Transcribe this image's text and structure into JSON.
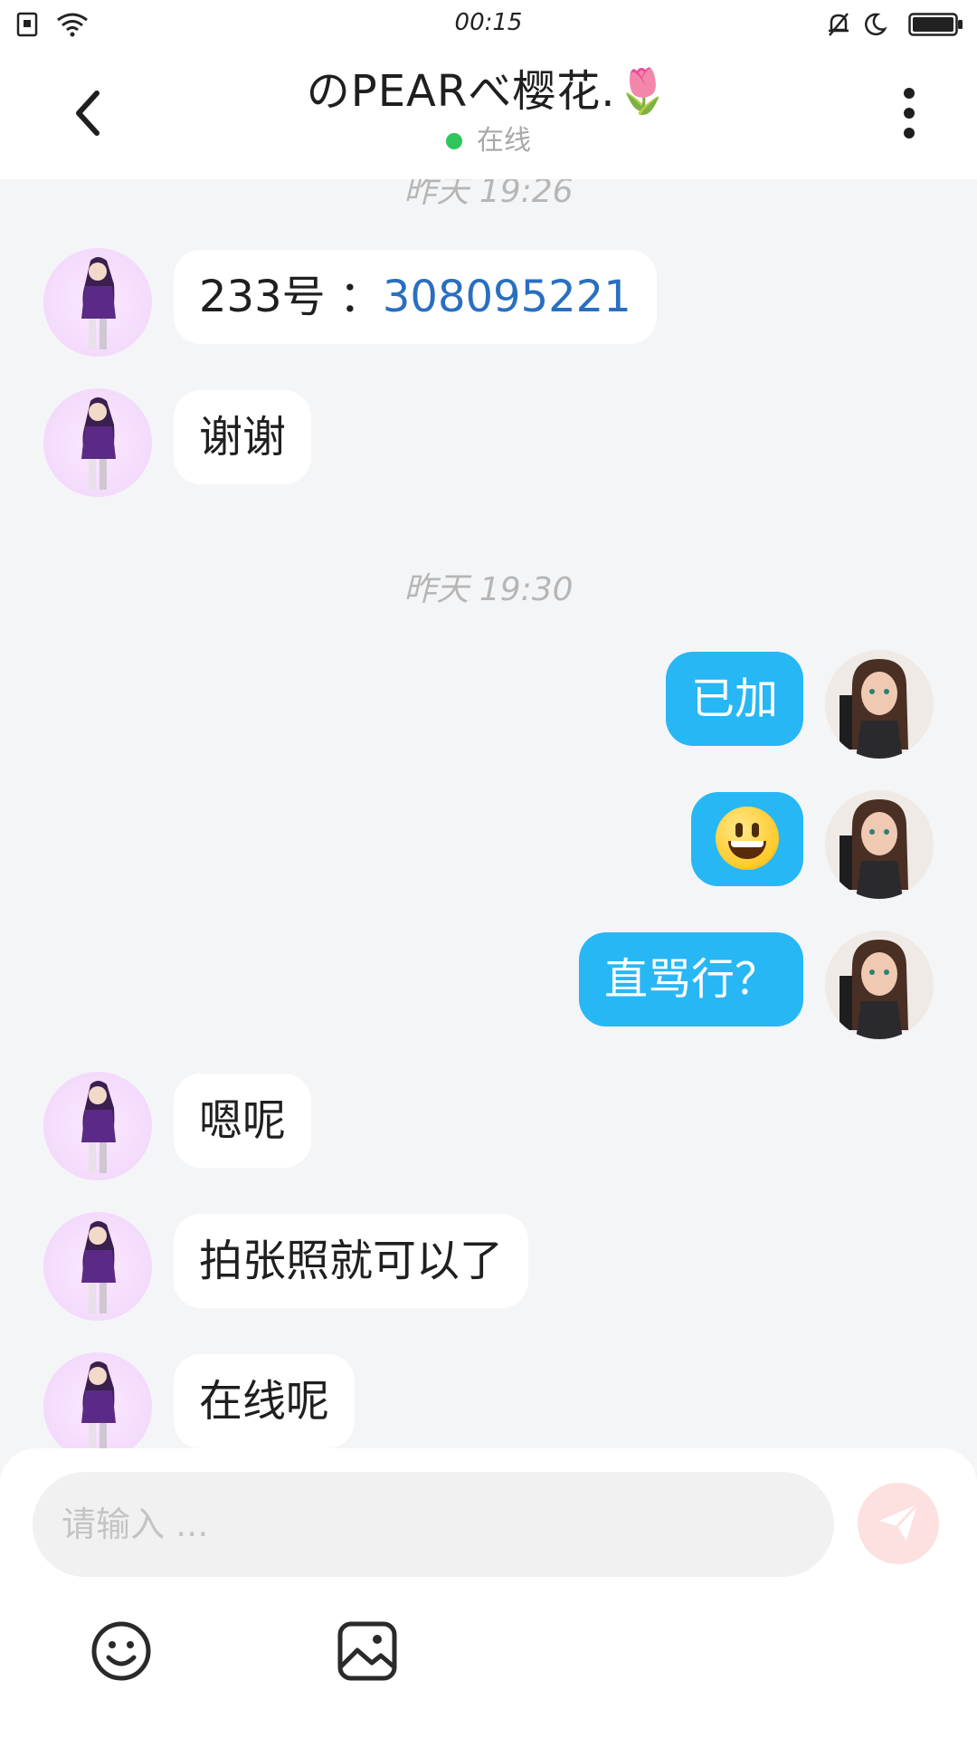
{
  "status_bar": {
    "time": "00:15",
    "icons": [
      "sim-card-icon",
      "wifi-icon",
      "mute-bell-icon",
      "moon-icon",
      "battery-icon"
    ]
  },
  "header": {
    "title": "のPEARべ樱花.🌷",
    "status": "在线",
    "back_icon": "chevron-left-icon",
    "more_icon": "more-vertical-icon"
  },
  "chat": {
    "timestamp_top": "昨天 19:26",
    "timestamp_mid": "昨天 19:30",
    "messages": [
      {
        "side": "in",
        "prefix": "233号 ：",
        "number": "308095221"
      },
      {
        "side": "in",
        "text": "谢谢"
      },
      {
        "side": "out",
        "text": "已加"
      },
      {
        "side": "out",
        "emoji": "smiley-emoji"
      },
      {
        "side": "out",
        "text": "直骂行？"
      },
      {
        "side": "in",
        "text": "嗯呢"
      },
      {
        "side": "in",
        "text": "拍张照就可以了"
      },
      {
        "side": "in",
        "text": "在线呢"
      }
    ]
  },
  "input": {
    "placeholder": "请输入 ...",
    "send_icon": "send-icon",
    "tools": [
      "emoji-icon",
      "image-icon"
    ]
  },
  "colors": {
    "outgoing_bubble": "#27b7f5",
    "incoming_bubble": "#ffffff",
    "online": "#2ec55b",
    "link": "#2a6fbf",
    "send_disabled": "#fde0e0"
  }
}
